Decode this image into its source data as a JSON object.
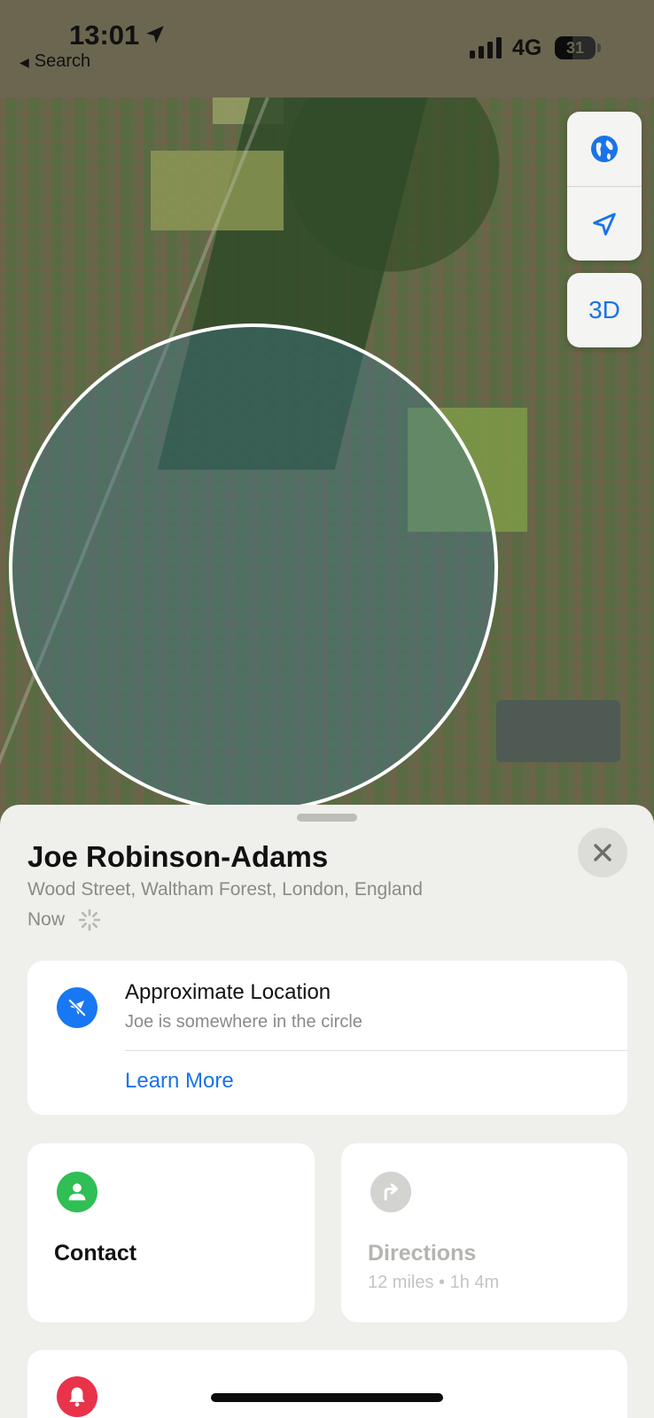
{
  "status_bar": {
    "time": "13:01",
    "back_label": "Search",
    "network": "4G",
    "battery": "31"
  },
  "map_controls": {
    "globe_icon": "globe-icon",
    "location_icon": "location-arrow-icon",
    "mode_3d_label": "3D"
  },
  "person": {
    "name": "Joe Robinson-Adams",
    "address": "Wood Street, Waltham Forest, London, England",
    "updated": "Now"
  },
  "location_card": {
    "title": "Approximate Location",
    "subtitle": "Joe is somewhere in the circle",
    "link": "Learn More",
    "icon": "location-slash-icon"
  },
  "actions": {
    "contact_label": "Contact",
    "directions_label": "Directions",
    "directions_meta": "12 miles • 1h 4m"
  },
  "colors": {
    "accent": "#1a73e8",
    "contact_green": "#2fbf55",
    "notify_red": "#e8334a"
  }
}
